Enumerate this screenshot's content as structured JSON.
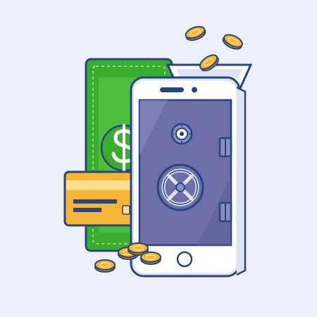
{
  "illustration": {
    "subject": "",
    "icons": {
      "banknote": "banknote-icon",
      "dollar": "dollar-sign-icon",
      "card": "credit-card-icon",
      "phone": "smartphone-icon",
      "vault": "vault-door-icon",
      "dial": "combination-dial-icon",
      "handle": "vault-handle-icon",
      "coin": "coin-icon"
    },
    "colors": {
      "background": "#edf0fa",
      "outline": "#27467f",
      "banknote_green": "#3aad2f",
      "banknote_light": "#5fcb4d",
      "card_orange": "#f6b536",
      "card_stripe": "#ffe08a",
      "phone_white": "#ffffff",
      "vault_purple": "#6e6eab",
      "vault_light": "#8d8dc4",
      "coin_gold": "#f6b536",
      "coin_shadow": "#e69b1e"
    }
  }
}
